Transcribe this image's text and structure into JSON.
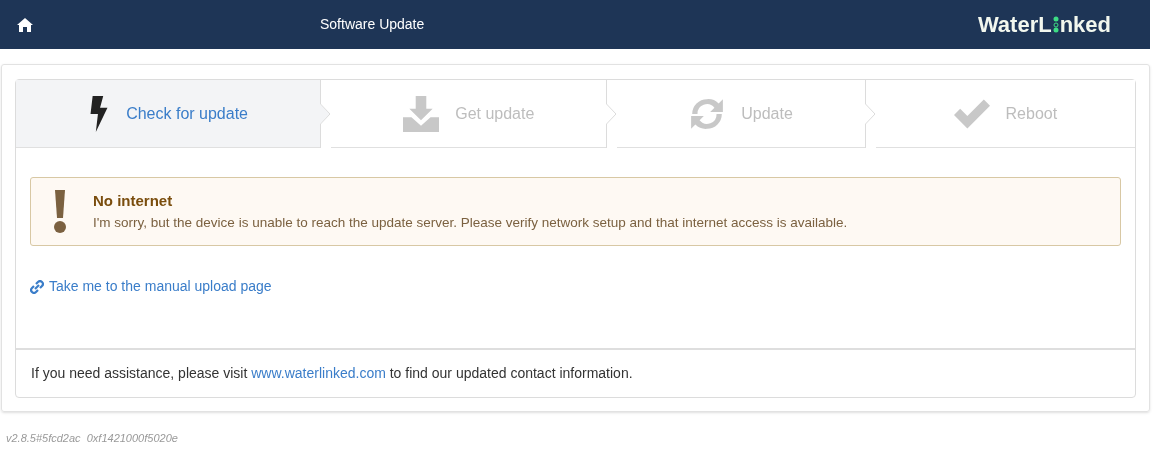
{
  "header": {
    "title": "Software Update",
    "logo": {
      "before": "WaterL",
      "after": "nked"
    }
  },
  "steps": [
    {
      "label": "Check for update",
      "kind": "bolt",
      "selected": true
    },
    {
      "label": "Get update",
      "kind": "download",
      "selected": false
    },
    {
      "label": "Update",
      "kind": "refresh",
      "selected": false
    },
    {
      "label": "Reboot",
      "kind": "check",
      "selected": false
    }
  ],
  "alert": {
    "title": "No internet",
    "message": "I'm sorry, but the device is unable to reach the update server. Please verify network setup and that internet access is available."
  },
  "manual_link": "Take me to the manual upload page",
  "footer": {
    "before": "If you need assistance, please visit ",
    "link": "www.waterlinked.com",
    "after": " to find our updated contact information."
  },
  "version": "v2.8.5#5fcd2ac  0xf1421000f5020e"
}
